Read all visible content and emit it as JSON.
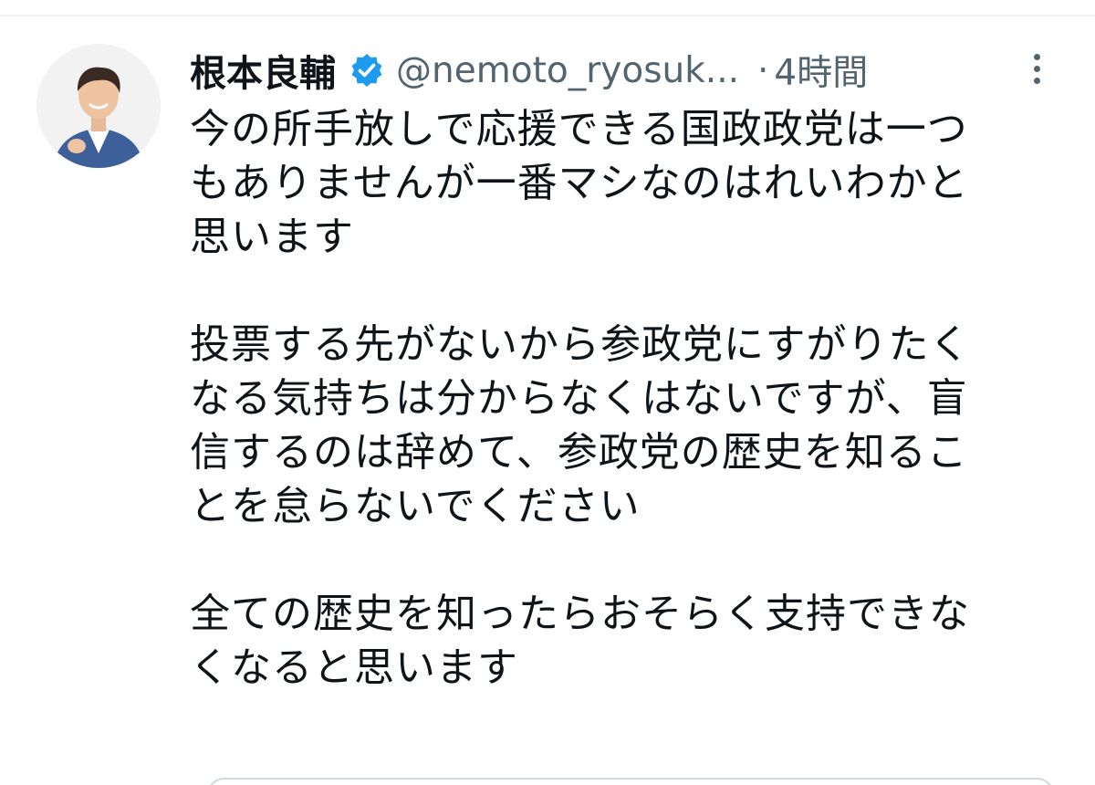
{
  "tweet": {
    "display_name": "根本良輔",
    "handle": "@nemoto_ryosuk...",
    "separator": "·",
    "time": "4時間",
    "verified_color": "#1d9bf0",
    "body": {
      "p1": [
        "今の所手放しで応援できる国政政党は一つ",
        "もありませんが一番マシなのはれいわかと",
        "思います"
      ],
      "p2": [
        "投票する先がないから参政党にすがりたく",
        "なる気持ちは分からなくはないですが、盲",
        "信するのは辞めて、参政党の歴史を知るこ",
        "とを怠らないでください"
      ],
      "p3": [
        "全ての歴史を知ったらおそらく支持できな",
        "くなると思います"
      ]
    }
  },
  "icons": {
    "avatar": "person-photo",
    "verified": "verified-badge-icon",
    "more": "more-vertical-icon"
  }
}
